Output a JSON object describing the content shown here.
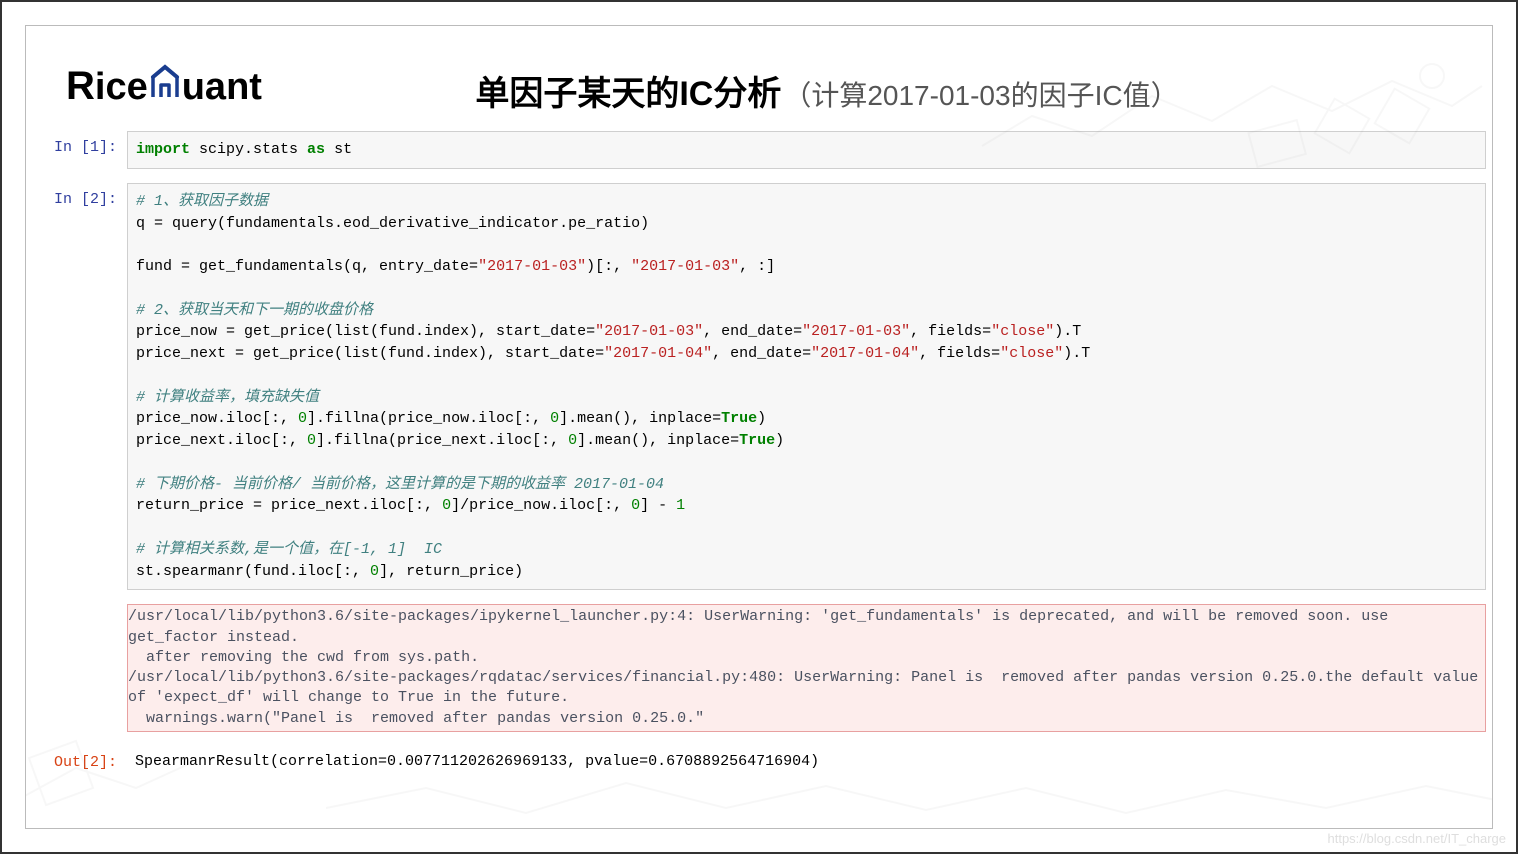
{
  "logo": {
    "part1": "R",
    "part2": "ice",
    "part3": "uant"
  },
  "title": {
    "main": "单因子某天的IC分析",
    "sub": "（计算2017-01-03的因子IC值）"
  },
  "watermark": "https://blog.csdn.net/IT_charge",
  "cell1": {
    "prompt": "In  [1]:",
    "code_import": "import",
    "code_mod": " scipy.stats ",
    "code_as": "as",
    "code_alias": " st"
  },
  "cell2": {
    "prompt": "In  [2]:",
    "c1": "# 1、获取因子数据",
    "l2a": "q = query(fundamentals.eod_derivative_indicator.pe_ratio)",
    "l3a": "fund = get_fundamentals(q, entry_date=",
    "l3s1": "\"2017-01-03\"",
    "l3b": ")[:, ",
    "l3s2": "\"2017-01-03\"",
    "l3c": ", :]",
    "c2": "# 2、获取当天和下一期的收盘价格",
    "l5a": "price_now = get_price(list(fund.index), start_date=",
    "l5s1": "\"2017-01-03\"",
    "l5b": ", end_date=",
    "l5s2": "\"2017-01-03\"",
    "l5c": ", fields=",
    "l5s3": "\"close\"",
    "l5d": ").T",
    "l6a": "price_next = get_price(list(fund.index), start_date=",
    "l6s1": "\"2017-01-04\"",
    "l6b": ", end_date=",
    "l6s2": "\"2017-01-04\"",
    "l6c": ", fields=",
    "l6s3": "\"close\"",
    "l6d": ").T",
    "c3": "# 计算收益率，填充缺失值",
    "l8a": "price_now.iloc[:, ",
    "n0a": "0",
    "l8b": "].fillna(price_now.iloc[:, ",
    "l8c": "].mean(), inplace=",
    "btrue": "True",
    "l8d": ")",
    "l9a": "price_next.iloc[:, ",
    "l9b": "].fillna(price_next.iloc[:, ",
    "l9c": "].mean(), inplace=",
    "l9d": ")",
    "c4": "# 下期价格- 当前价格/ 当前价格，这里计算的是下期的收益率 2017-01-04",
    "l11a": "return_price = price_next.iloc[:, ",
    "l11b": "]/price_now.iloc[:, ",
    "l11c": "] - ",
    "n1": "1",
    "c5": "# 计算相关系数,是一个值，在[-1, 1]  IC",
    "l13a": "st.spearmanr(fund.iloc[:, ",
    "l13b": "], return_price)"
  },
  "warn": {
    "text": "/usr/local/lib/python3.6/site-packages/ipykernel_launcher.py:4: UserWarning: 'get_fundamentals' is deprecated, and will be removed soon. use get_factor instead.\n  after removing the cwd from sys.path.\n/usr/local/lib/python3.6/site-packages/rqdatac/services/financial.py:480: UserWarning: Panel is  removed after pandas version 0.25.0.the default value of 'expect_df' will change to True in the future.\n  warnings.warn(\"Panel is  removed after pandas version 0.25.0.\""
  },
  "out": {
    "prompt": "Out[2]:",
    "text": "SpearmanrResult(correlation=0.007711202626969133, pvalue=0.6708892564716904)"
  }
}
